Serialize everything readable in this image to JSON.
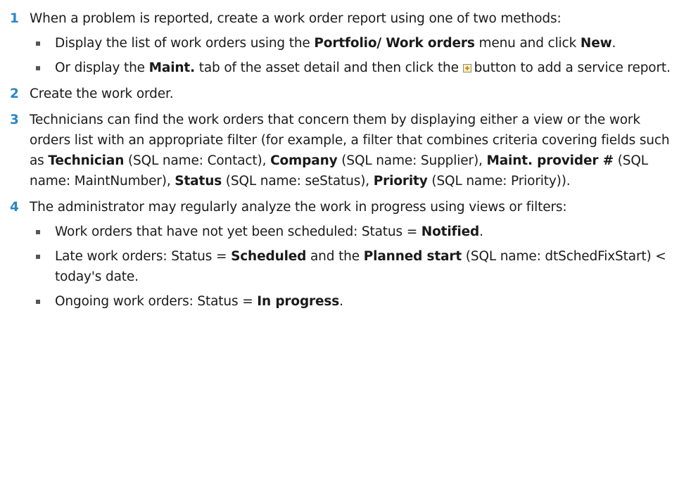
{
  "steps": [
    {
      "number": "1",
      "text": "When a problem is reported, create a work order report using one of two methods:",
      "bullets": [
        {
          "a": "Display the list of work orders using the ",
          "b1": "Portfolio/ Work orders",
          "c": " menu and click ",
          "b2": "New",
          "d": "."
        },
        {
          "a": "Or display the ",
          "b1": "Maint.",
          "c": " tab of the asset detail and then click the ",
          "icon": "add-icon",
          "d": "button to add a service report."
        }
      ]
    },
    {
      "number": "2",
      "text": "Create the work order."
    },
    {
      "number": "3",
      "text": "Technicians can find the work orders that concern them by displaying either a view or the work orders list with an appropriate filter (for example, a filter that combines criteria covering fields such as ",
      "f1": "Technician",
      "s1": " (SQL name: Contact), ",
      "f2": "Company",
      "s2": " (SQL name: Supplier), ",
      "f3": "Maint. provider #",
      "s3": " (SQL name: MaintNumber), ",
      "f4": "Status",
      "s4": " (SQL name: seStatus), ",
      "f5": "Priority",
      "s5": " (SQL name: Priority))."
    },
    {
      "number": "4",
      "text": "The administrator may regularly analyze the work in progress using views or filters:",
      "bullets": [
        {
          "a": "Work orders that have not yet been scheduled: Status = ",
          "b1": "Notified",
          "c": "."
        },
        {
          "a": "Late work orders: Status = ",
          "b1": "Scheduled",
          "c": " and the ",
          "b2": "Planned start",
          "d": " (SQL name: dtSchedFixStart) < today's date."
        },
        {
          "a": "Ongoing work orders: Status = ",
          "b1": "In progress",
          "c": "."
        }
      ]
    }
  ],
  "colors": {
    "step_number": "#2a86c6",
    "text": "#1a1a1a",
    "bullet": "#555555",
    "add_icon_plus": "#e08a00"
  }
}
